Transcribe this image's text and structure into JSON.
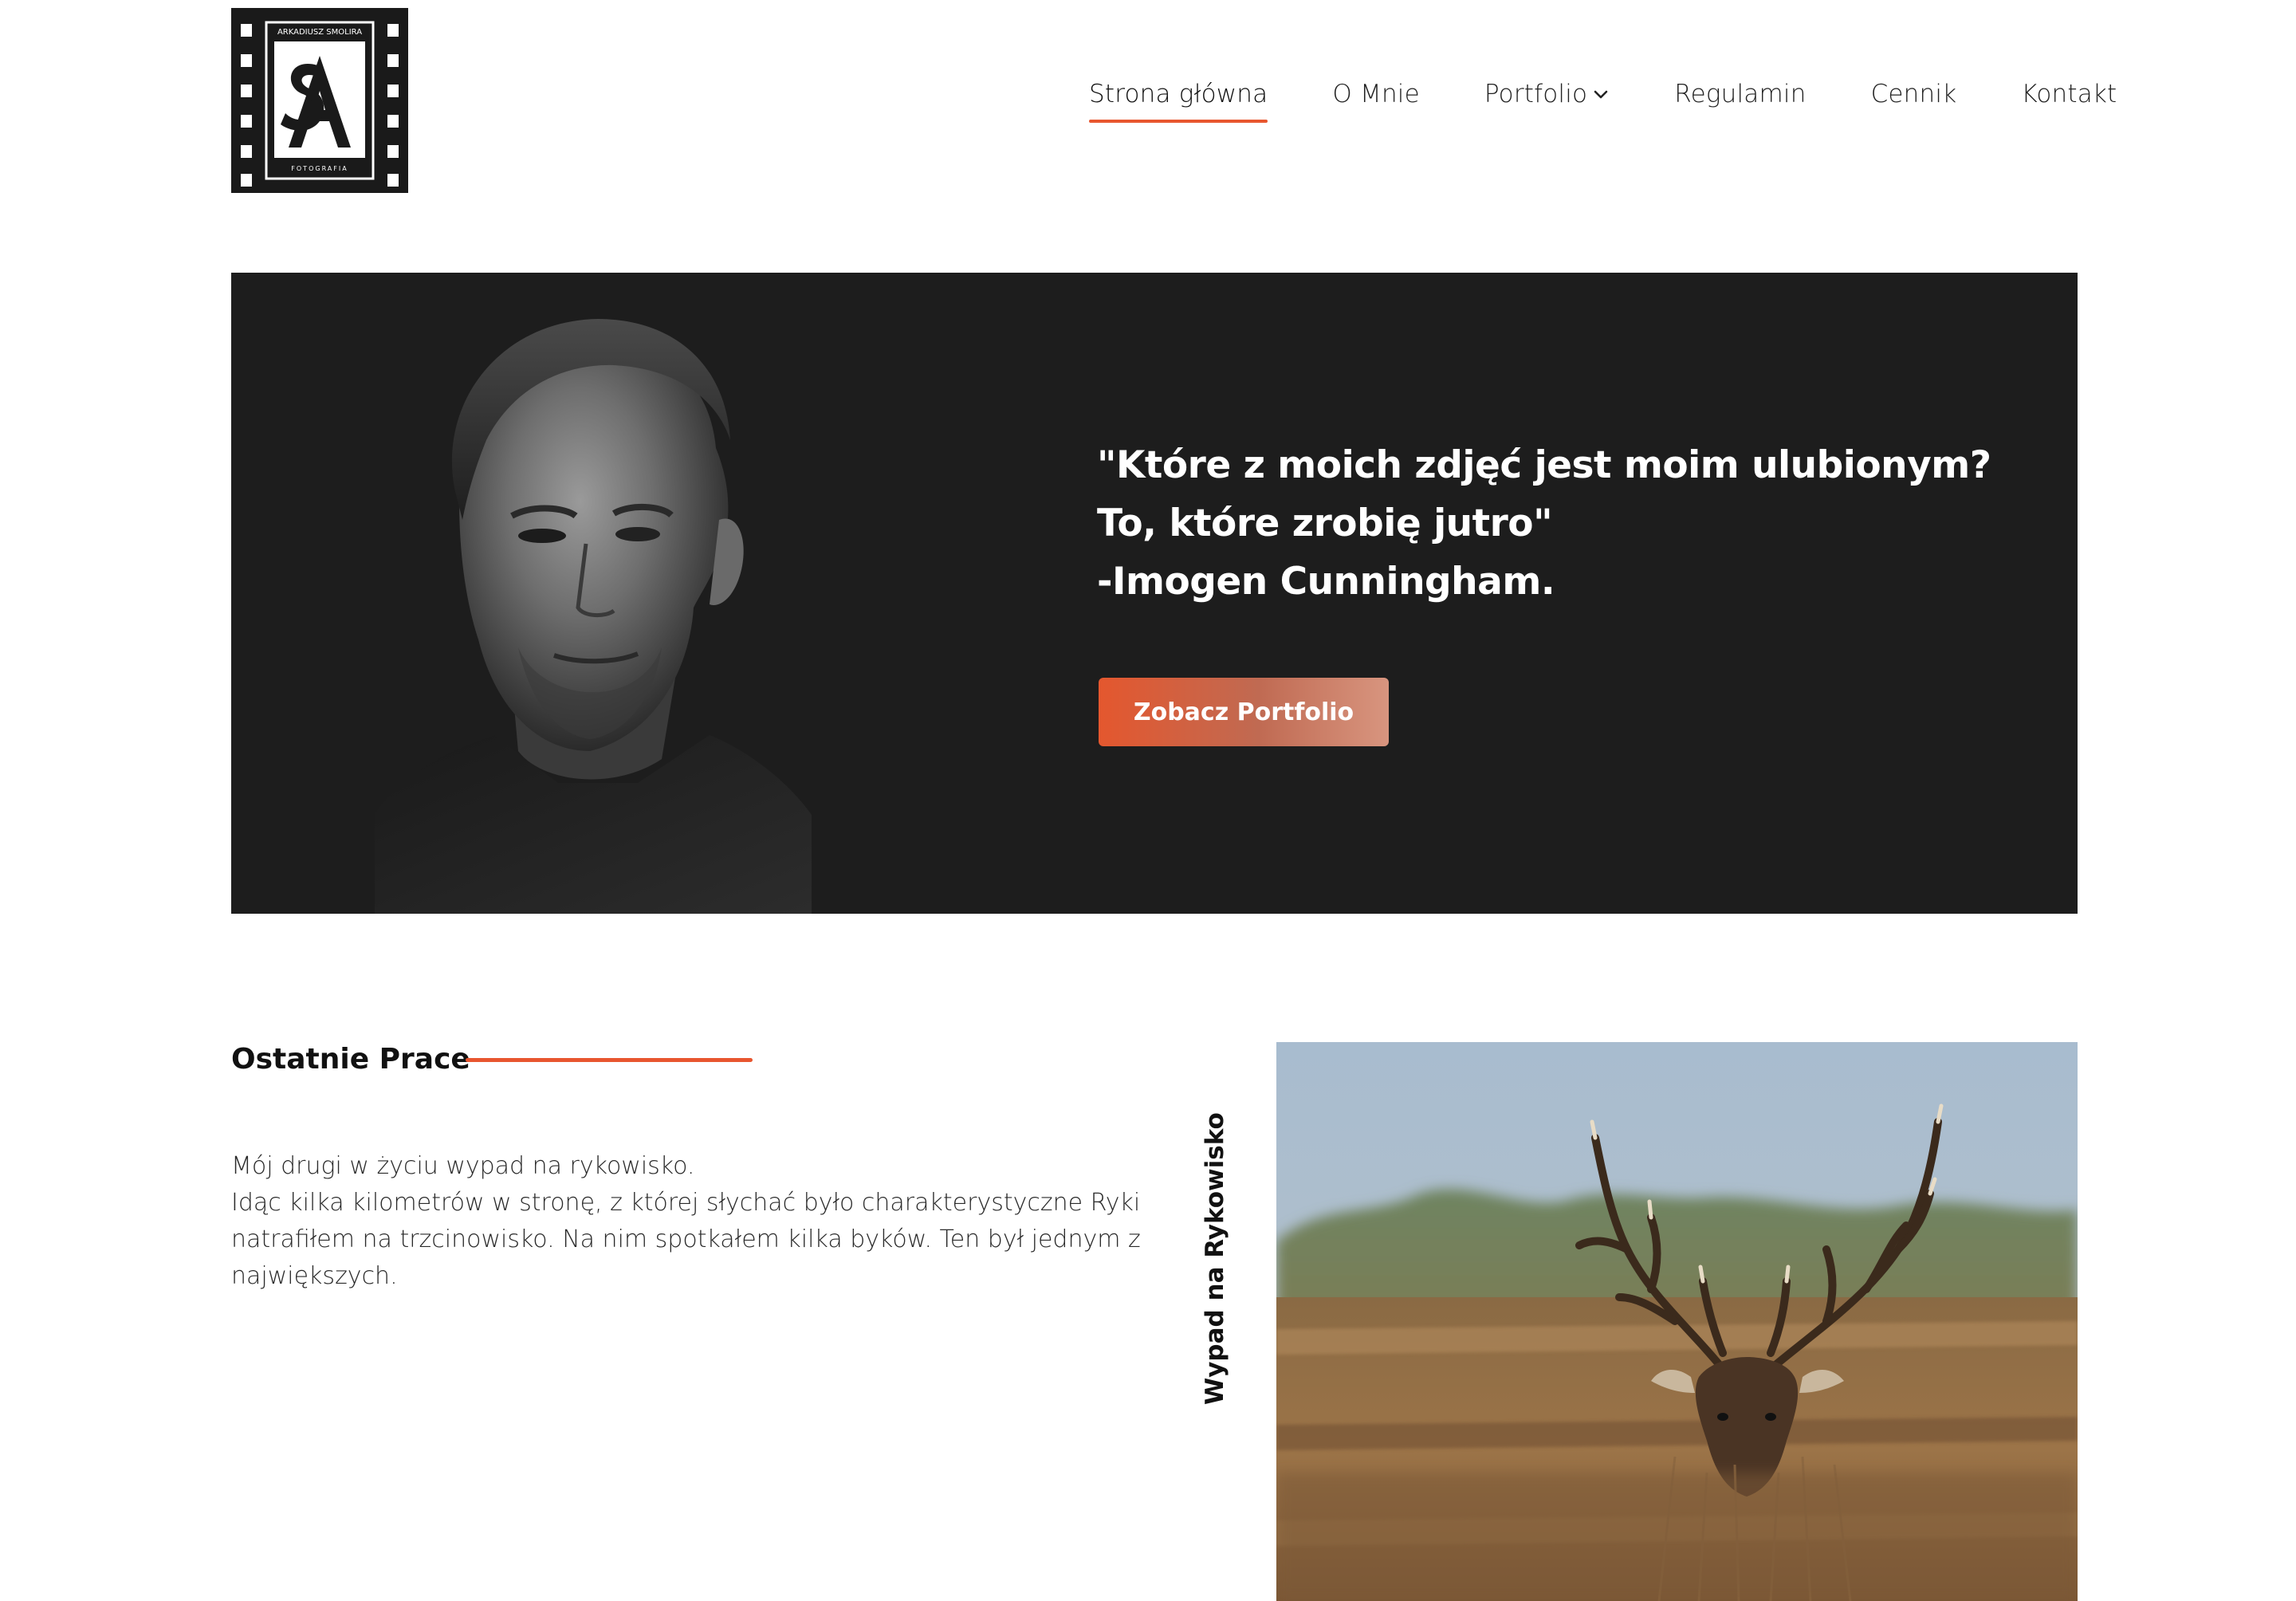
{
  "brand": {
    "logo_top_text": "ARKADIUSZ SMOLIRA",
    "logo_bottom_text": "FOTOGRAFIA",
    "logo_initials": "SA"
  },
  "nav": {
    "items": [
      {
        "label": "Strona główna",
        "active": true
      },
      {
        "label": "O Mnie",
        "active": false
      },
      {
        "label": "Portfolio",
        "active": false,
        "has_dropdown": true
      },
      {
        "label": "Regulamin",
        "active": false
      },
      {
        "label": "Cennik",
        "active": false
      },
      {
        "label": "Kontakt",
        "active": false
      }
    ]
  },
  "hero": {
    "quote_lines": [
      "\"Które z moich zdjęć jest moim ulubionym?",
      "To, które zrobię jutro\"",
      "-Imogen Cunningham."
    ],
    "cta_label": "Zobacz Portfolio"
  },
  "recent": {
    "title": "Ostatnie Prace",
    "paragraph_lines": [
      "Mój drugi w życiu wypad na rykowisko.",
      "Idąc kilka kilometrów w stronę, z której słychać było charakterystyczne Ryki natrafiłem na trzcinowisko. Na nim spotkałem kilka byków. Ten był jednym z największych."
    ],
    "vertical_title": "Wypad na Rykowisko"
  },
  "colors": {
    "accent": "#e8562f",
    "hero_bg": "#1d1d1d",
    "text": "#1b1b1b"
  }
}
